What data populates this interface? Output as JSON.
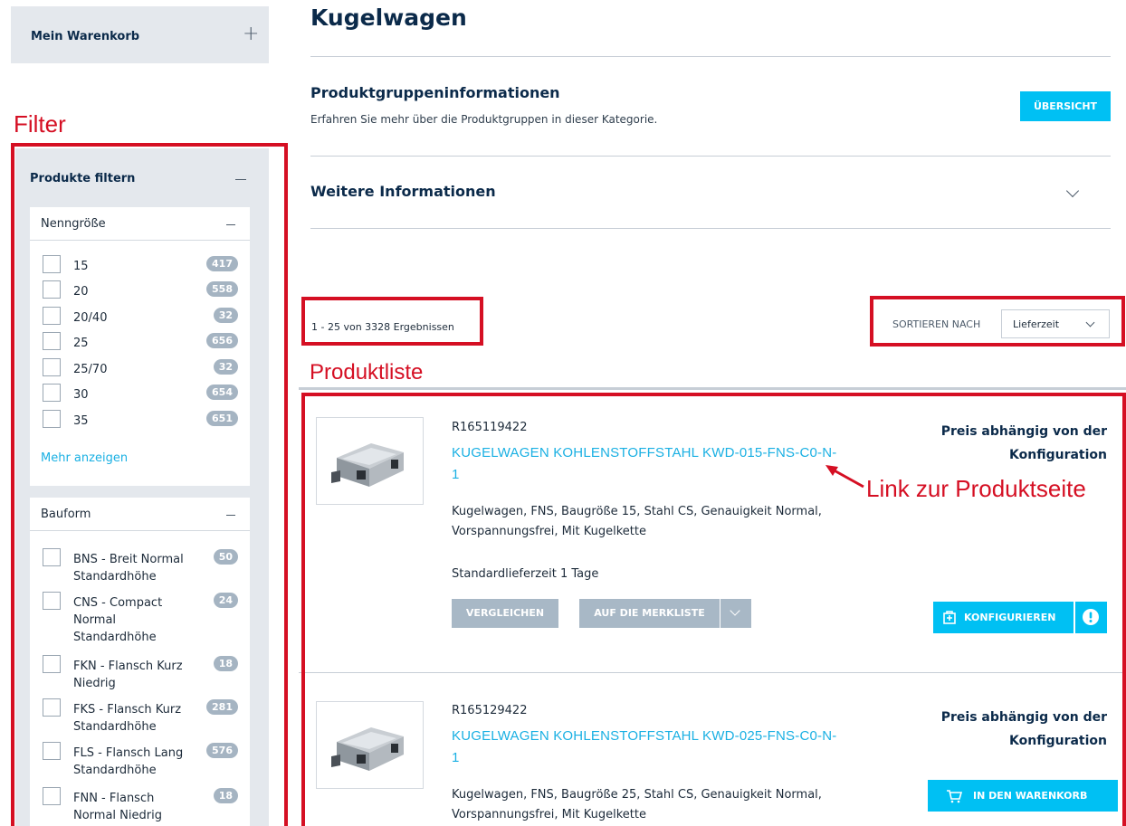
{
  "sidebar": {
    "cart_title": "Mein Warenkorb",
    "filter_heading": "Produkte filtern",
    "facets": [
      {
        "title": "Nenngröße",
        "options": [
          {
            "label": "15",
            "count": "417"
          },
          {
            "label": "20",
            "count": "558"
          },
          {
            "label": "20/40",
            "count": "32"
          },
          {
            "label": "25",
            "count": "656"
          },
          {
            "label": "25/70",
            "count": "32"
          },
          {
            "label": "30",
            "count": "654"
          },
          {
            "label": "35",
            "count": "651"
          }
        ],
        "more_link": "Mehr anzeigen"
      },
      {
        "title": "Bauform",
        "options": [
          {
            "line1": "BNS - Breit Normal",
            "line2": "Standardhöhe",
            "line3": "",
            "count": "50"
          },
          {
            "line1": "CNS - Compact",
            "line2": "Normal",
            "line3": "Standardhöhe",
            "count": "24"
          },
          {
            "line1": "FKN - Flansch Kurz",
            "line2": "Niedrig",
            "line3": "",
            "count": "18"
          },
          {
            "line1": "FKS - Flansch Kurz",
            "line2": "Standardhöhe",
            "line3": "",
            "count": "281"
          },
          {
            "line1": "FLS - Flansch Lang",
            "line2": "Standardhöhe",
            "line3": "",
            "count": "576"
          },
          {
            "line1": "FNN - Flansch",
            "line2": "Normal Niedrig",
            "line3": "",
            "count": "18"
          }
        ]
      }
    ]
  },
  "annotations": {
    "filter": "Filter",
    "product_list": "Produktliste",
    "product_link": "Link zur Produktseite"
  },
  "main": {
    "title": "Kugelwagen",
    "group_info_title": "Produktgruppeninformationen",
    "group_info_desc": "Erfahren Sie mehr über die Produktgruppen in dieser Kategorie.",
    "overview_button": "ÜBERSICHT",
    "more_info_title": "Weitere Informationen",
    "results_text": "1 - 25 von 3328 Ergebnissen",
    "sort_label": "SORTIEREN NACH",
    "sort_value": "Lieferzeit"
  },
  "products": [
    {
      "number": "R165119422",
      "link_line1": "KUGELWAGEN KOHLENSTOFFSTAHL KWD-015-FNS-C0-N-",
      "link_line2": "1",
      "desc_line1": "Kugelwagen, FNS, Baugröße 15, Stahl CS, Genauigkeit Normal,",
      "desc_line2": "Vorspannungsfrei, Mit Kugelkette",
      "delivery": "Standardlieferzeit 1 Tage",
      "price_line1": "Preis abhängig von der",
      "price_line2": "Konfiguration",
      "compare_button": "VERGLEICHEN",
      "wishlist_button": "AUF DIE MERKLISTE",
      "configure_button": "KONFIGURIEREN"
    },
    {
      "number": "R165129422",
      "link_line1": "KUGELWAGEN KOHLENSTOFFSTAHL KWD-025-FNS-C0-N-",
      "link_line2": "1",
      "desc_line1": "Kugelwagen, FNS, Baugröße 25, Stahl CS, Genauigkeit Normal,",
      "desc_line2": "Vorspannungsfrei, Mit Kugelkette",
      "price_line1": "Preis abhängig von der",
      "price_line2": "Konfiguration",
      "cart_button": "IN DEN WARENKORB"
    }
  ],
  "colors": {
    "accent": "#00c0f3",
    "link": "#1ab0e3",
    "annotation_red": "#d50f23",
    "panel_gray": "#e4e8ed",
    "button_gray": "#a8b8c6",
    "badge_gray": "#a5b4c2"
  }
}
